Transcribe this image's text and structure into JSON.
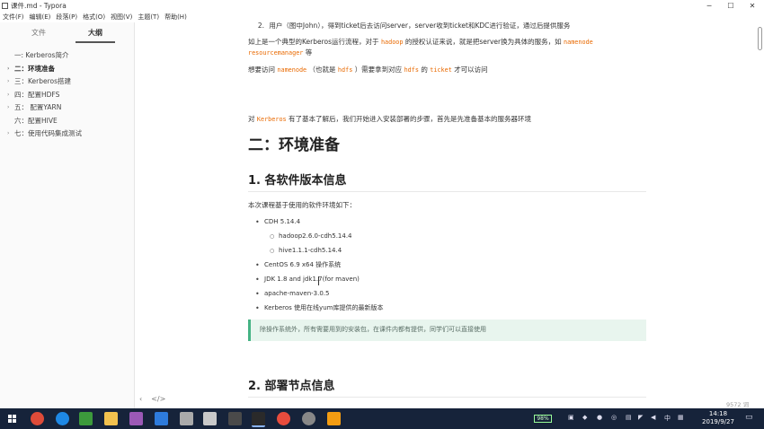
{
  "window": {
    "title": "课件.md - Typora",
    "minimize": "─",
    "maximize": "☐",
    "close": "✕"
  },
  "menu": [
    "文件(F)",
    "编辑(E)",
    "段落(P)",
    "格式(O)",
    "视图(V)",
    "主题(T)",
    "帮助(H)"
  ],
  "sidebar": {
    "tabs": [
      "文件",
      "大纲"
    ],
    "outline": [
      {
        "label": "一: Kerberos简介",
        "arrow": "",
        "active": false
      },
      {
        "label": "二：环境准备",
        "arrow": "›",
        "active": true
      },
      {
        "label": "三：Kerberos搭建",
        "arrow": "›",
        "active": false
      },
      {
        "label": "四：配置HDFS",
        "arrow": "›",
        "active": false
      },
      {
        "label": "五： 配置YARN",
        "arrow": "›",
        "active": false
      },
      {
        "label": "六：配置HIVE",
        "arrow": "",
        "active": false
      },
      {
        "label": "七：使用代码集成测试",
        "arrow": "›",
        "active": false
      }
    ],
    "bottom_left": "‹",
    "bottom_code": "</>"
  },
  "doc": {
    "line1_num": "2.",
    "line1": "用户（图中John），得到ticket后去访问server，server收到ticket和KDC进行验证，通过后提供服务",
    "p2_a": "如上是一个典型的Kerberos运行流程，对于",
    "p2_code1": "hadoop",
    "p2_b": "的授权认证来说，就是把server换为具体的服务，如",
    "p2_code2": "namenode",
    "p2_code3": "resourcemanager",
    "p2_c": "等",
    "p3_a": "想要访问",
    "p3_code1": "namenode",
    "p3_b": "（也就是",
    "p3_code2": "hdfs",
    "p3_c": "）需要拿到对应",
    "p3_code3": "hdfs",
    "p3_d": "的",
    "p3_code4": "ticket",
    "p3_e": "才可以访问",
    "p4_a": "对",
    "p4_code": "Kerberos",
    "p4_b": "有了基本了解后，我们开始进入安装部署的步骤，首先是先准备基本的服务器环境",
    "h2": "二：环境准备",
    "h3_1": "1. 各软件版本信息",
    "intro": "本次课程基于使用的软件环境如下：",
    "list": [
      {
        "text": "CDH 5.14.4",
        "sub": false
      },
      {
        "text": "hadoop2.6.0-cdh5.14.4",
        "sub": true
      },
      {
        "text": "hive1.1.1-cdh5.14.4",
        "sub": true
      },
      {
        "text": "CentOS 6.9 x64 操作系统",
        "sub": false
      },
      {
        "text": "JDK 1.8 and jdk1.7(for maven)",
        "sub": false
      },
      {
        "text": "apache-maven-3.0.5",
        "sub": false
      },
      {
        "text": "Kerberos 使用在线yum库提供的最新版本",
        "sub": false
      }
    ],
    "note": "除操作系统外，所有需要用到的安装包，在课件内都有提供，同学们可以直接使用",
    "h3_2": "2. 部署节点信息",
    "word_count": "9572 词"
  },
  "taskbar": {
    "battery": "98%",
    "ime": "中",
    "time": "14:18",
    "date": "2019/9/27",
    "colors": {
      "start": "#ffffff",
      "chrome": "#dd4b39",
      "ie": "#1e88e5",
      "app3": "#3c9a3c",
      "folder": "#f2c14e",
      "idea": "#9b59b6",
      "app6": "#2e7bdc",
      "app7": "#aaaaaa",
      "app8": "#c9c9c9",
      "app9": "#4a4a4a",
      "typora": "#2a2a2a",
      "app11": "#e84c3d",
      "settings": "#888888",
      "app13": "#f39c12"
    }
  }
}
